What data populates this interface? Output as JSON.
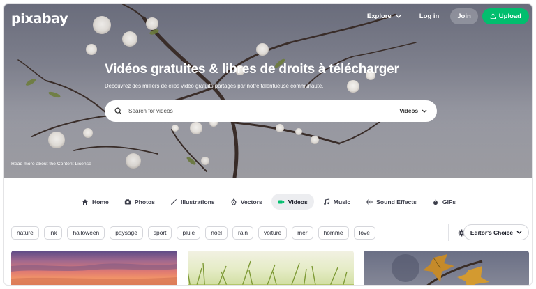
{
  "brand": {
    "logo_text": "pixabay"
  },
  "topnav": {
    "explore_label": "Explore",
    "login_label": "Log in",
    "join_label": "Join",
    "upload_label": "Upload"
  },
  "hero": {
    "title": "Vidéos gratuites & libres de droits à télécharger",
    "subtitle": "Découvrez des milliers de clips vidéo gratuits partagés par notre talentueuse communauté.",
    "license_prefix": "Read more about the",
    "license_link": "Content License"
  },
  "search": {
    "placeholder": "Search for videos",
    "value": "",
    "type_selected": "Videos"
  },
  "tabs": [
    {
      "label": "Home",
      "icon": "home-icon",
      "active": false
    },
    {
      "label": "Photos",
      "icon": "camera-icon",
      "active": false
    },
    {
      "label": "Illustrations",
      "icon": "brush-icon",
      "active": false
    },
    {
      "label": "Vectors",
      "icon": "pen-nib-icon",
      "active": false
    },
    {
      "label": "Videos",
      "icon": "video-icon",
      "active": true
    },
    {
      "label": "Music",
      "icon": "music-note-icon",
      "active": false
    },
    {
      "label": "Sound Effects",
      "icon": "waveform-icon",
      "active": false
    },
    {
      "label": "GIFs",
      "icon": "flame-icon",
      "active": false
    }
  ],
  "tags": [
    "nature",
    "ink",
    "halloween",
    "paysage",
    "sport",
    "pluie",
    "noel",
    "rain",
    "voiture",
    "mer",
    "homme",
    "love"
  ],
  "sort": {
    "selected": "Editor's Choice"
  },
  "colors": {
    "accent_green": "#02be6e",
    "active_tab_bg": "#ecedf0"
  }
}
